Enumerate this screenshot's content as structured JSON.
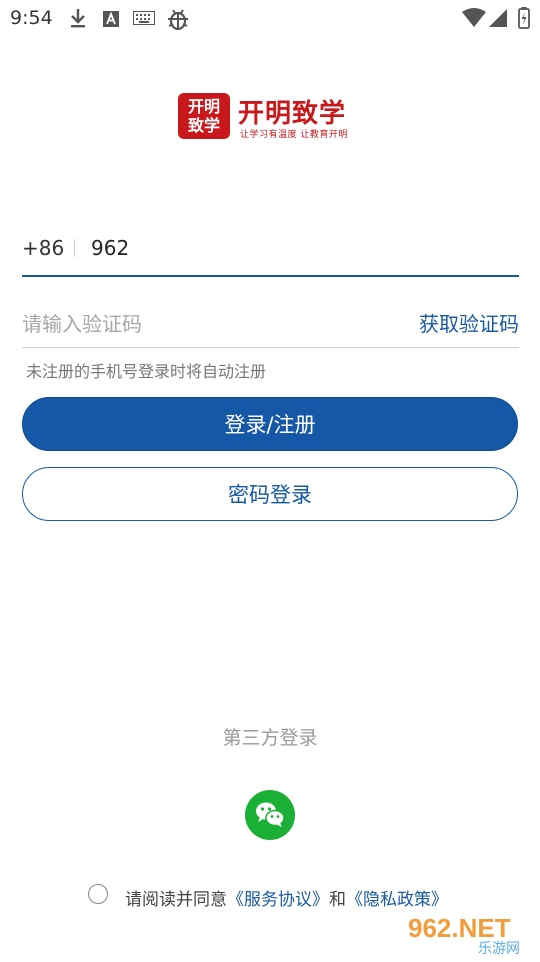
{
  "status_bar": {
    "time": "9:54",
    "icons": [
      "download-icon",
      "font-icon",
      "keyboard-icon",
      "bug-icon",
      "wifi-icon",
      "signal-icon",
      "battery-icon"
    ]
  },
  "logo": {
    "box_line1": "开明",
    "box_line2": "致学",
    "title": "开明致学",
    "slogan": "让学习有温度 让教育开明"
  },
  "form": {
    "country_code": "+86",
    "phone_value": "962",
    "code_placeholder": "请输入验证码",
    "get_code_label": "获取验证码",
    "hint": "未注册的手机号登录时将自动注册",
    "login_register_label": "登录/注册",
    "password_login_label": "密码登录"
  },
  "third_party": {
    "label": "第三方登录",
    "providers": [
      "wechat-icon"
    ]
  },
  "agreement": {
    "prefix": "请阅读并同意",
    "service_link": "《服务协议》",
    "and": "和",
    "privacy_link": "《隐私政策》",
    "checked": false
  },
  "watermark": {
    "main": "962.NET",
    "sub": "乐游网"
  },
  "colors": {
    "brand_red": "#c8181c",
    "primary_blue": "#1558a7",
    "wechat_green": "#1ab036"
  }
}
